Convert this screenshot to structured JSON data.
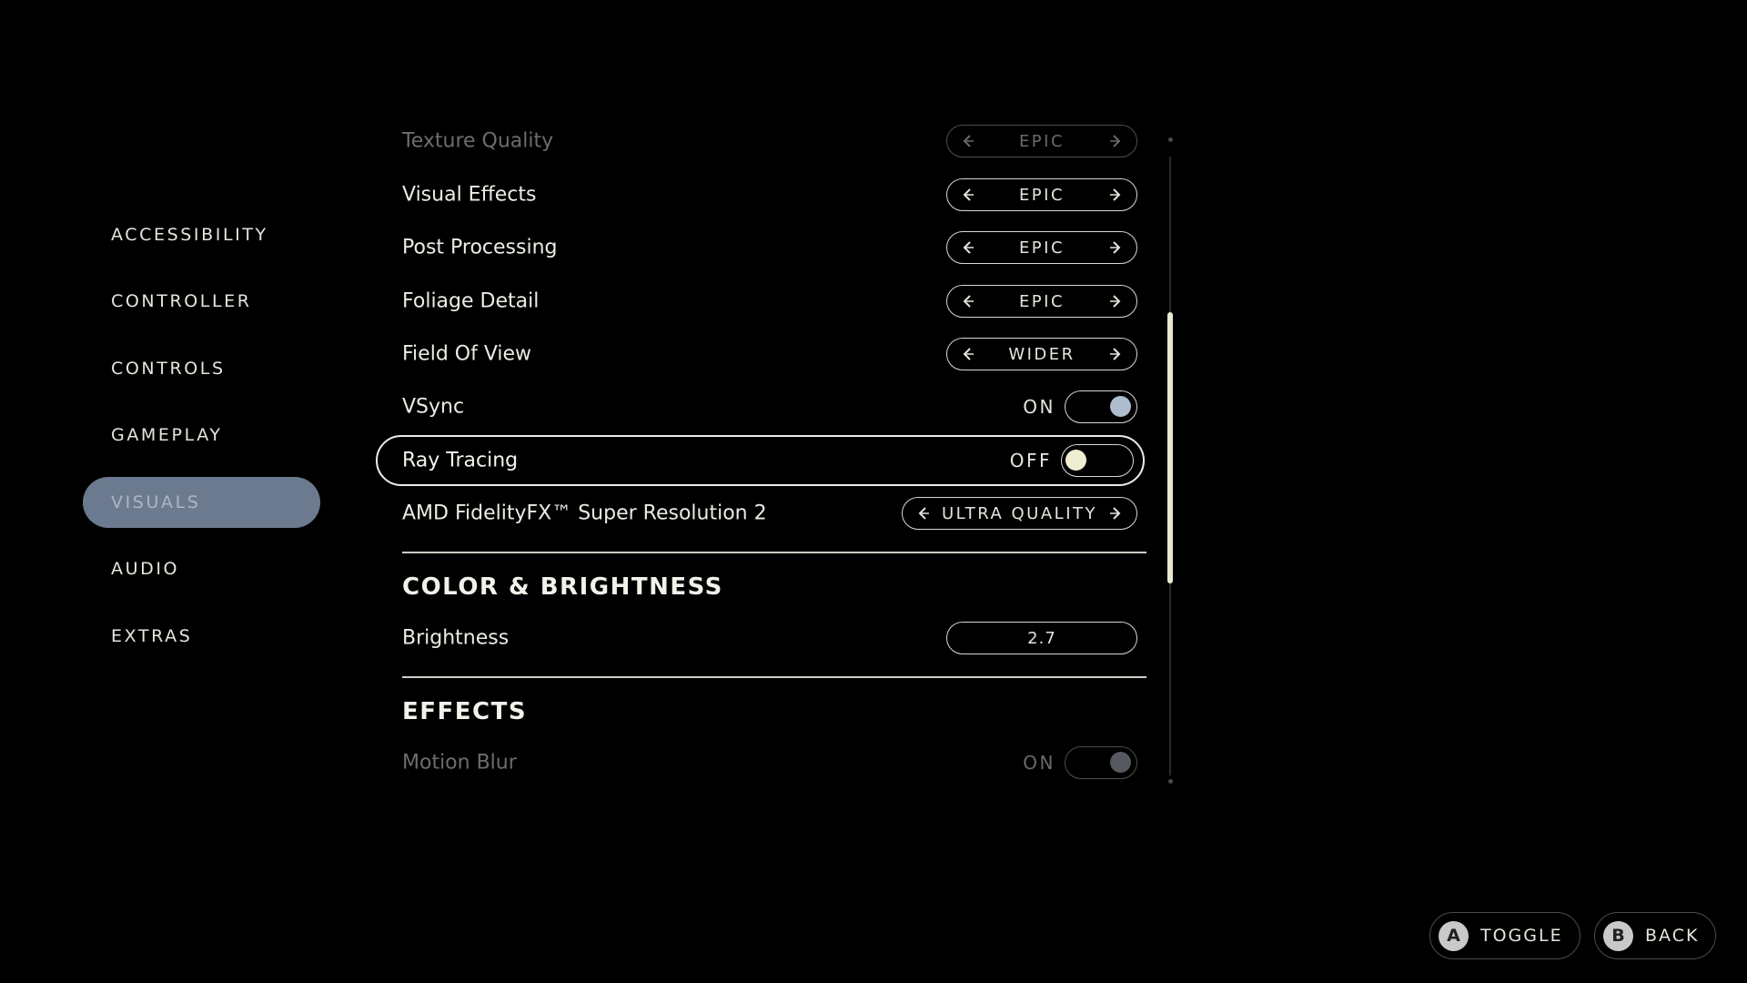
{
  "sidebar": {
    "items": [
      {
        "label": "ACCESSIBILITY",
        "active": false
      },
      {
        "label": "CONTROLLER",
        "active": false
      },
      {
        "label": "CONTROLS",
        "active": false
      },
      {
        "label": "GAMEPLAY",
        "active": false
      },
      {
        "label": "VISUALS",
        "active": true
      },
      {
        "label": "AUDIO",
        "active": false
      },
      {
        "label": "EXTRAS",
        "active": false
      }
    ]
  },
  "settings": {
    "texture_quality": {
      "label": "Texture Quality",
      "value": "EPIC"
    },
    "visual_effects": {
      "label": "Visual Effects",
      "value": "EPIC"
    },
    "post_processing": {
      "label": "Post Processing",
      "value": "EPIC"
    },
    "foliage_detail": {
      "label": "Foliage Detail",
      "value": "EPIC"
    },
    "field_of_view": {
      "label": "Field Of View",
      "value": "WIDER"
    },
    "vsync": {
      "label": "VSync",
      "state": "ON"
    },
    "ray_tracing": {
      "label": "Ray Tracing",
      "state": "OFF"
    },
    "fsr": {
      "label": "AMD FidelityFX™ Super Resolution 2",
      "value": "ULTRA QUALITY"
    }
  },
  "color_brightness": {
    "title": "COLOR & BRIGHTNESS",
    "brightness": {
      "label": "Brightness",
      "value": "2.7"
    }
  },
  "effects": {
    "title": "EFFECTS",
    "motion_blur": {
      "label": "Motion Blur",
      "state": "ON"
    }
  },
  "hints": {
    "toggle": {
      "button": "A",
      "label": "TOGGLE"
    },
    "back": {
      "button": "B",
      "label": "BACK"
    }
  },
  "colors": {
    "background": "#000000",
    "active_tab": "#6b7a8e",
    "toggle_on_knob": "#aebccd",
    "toggle_off_knob": "#efeed3",
    "scroll_thumb": "#e9e7d3"
  },
  "icons": {
    "arrow_left": "chevron-left-icon",
    "arrow_right": "chevron-right-icon"
  }
}
